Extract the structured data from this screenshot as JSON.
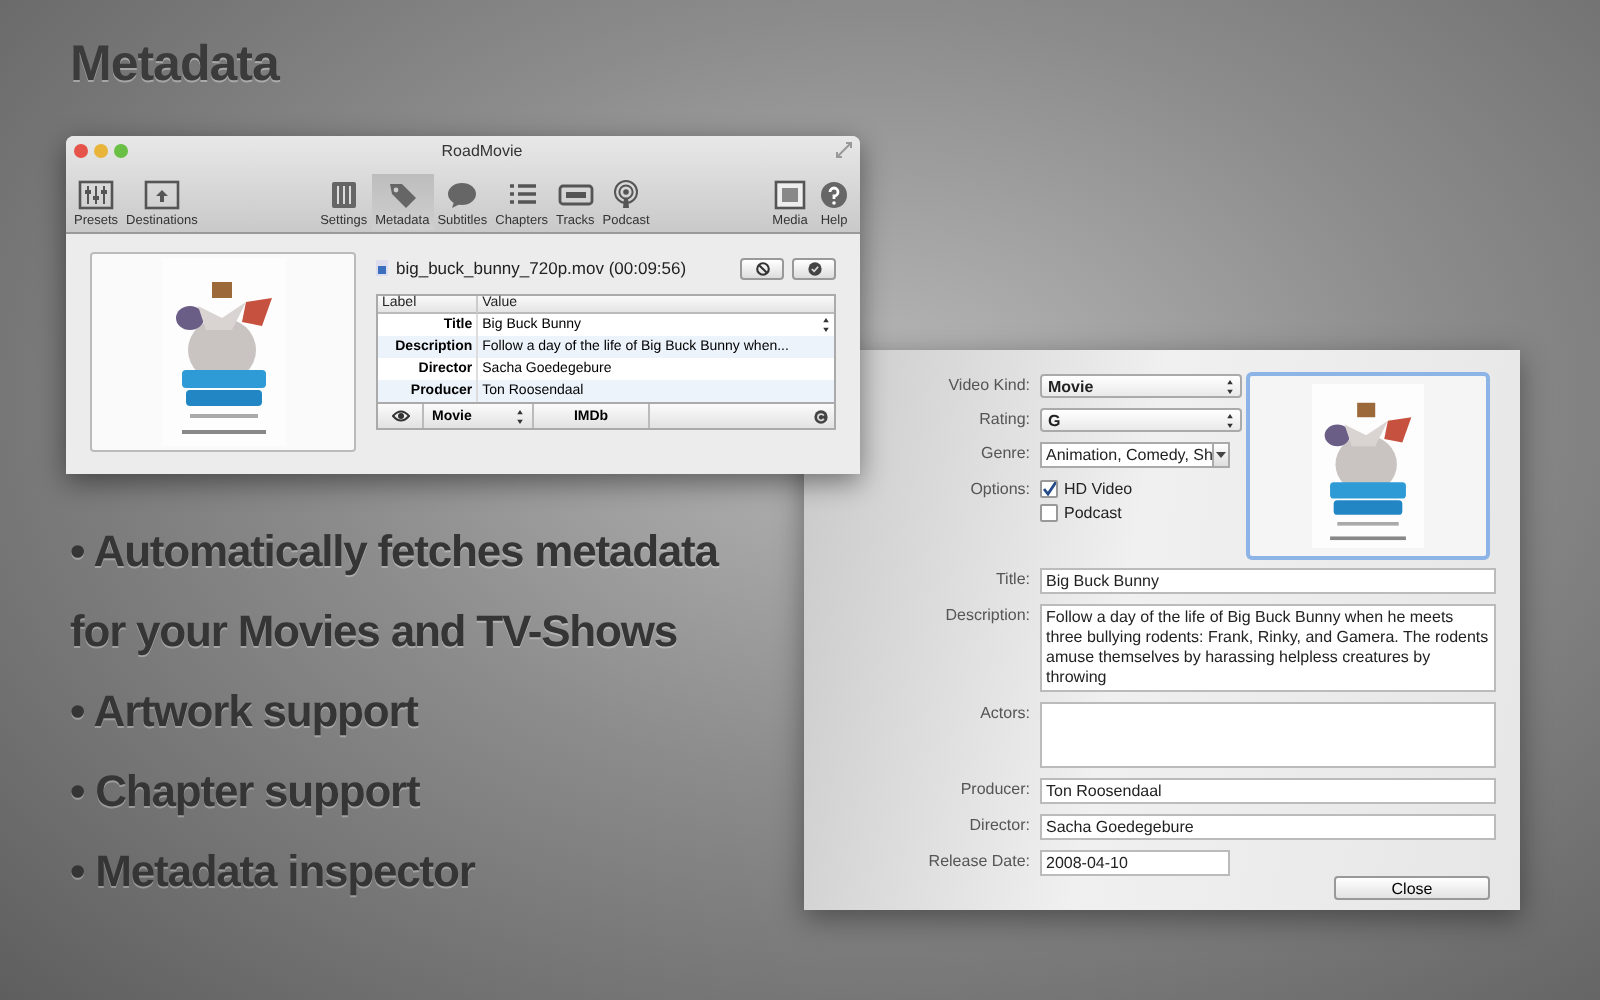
{
  "heading": "Metadata",
  "main_window": {
    "title": "RoadMovie",
    "toolbar_groups": [
      [
        {
          "label": "Presets",
          "selected": false
        },
        {
          "label": "Destinations",
          "selected": false
        }
      ],
      [
        {
          "label": "Settings",
          "selected": false
        },
        {
          "label": "Metadata",
          "selected": true
        },
        {
          "label": "Subtitles",
          "selected": false
        },
        {
          "label": "Chapters",
          "selected": false
        },
        {
          "label": "Tracks",
          "selected": false
        },
        {
          "label": "Podcast",
          "selected": false
        }
      ],
      [
        {
          "label": "Media",
          "selected": false
        },
        {
          "label": "Help",
          "selected": false
        }
      ]
    ],
    "file": "big_buck_bunny_720p.mov (00:09:56)",
    "table": {
      "columns": [
        "Label",
        "Value"
      ],
      "rows": [
        {
          "label": "Title",
          "value": "Big Buck Bunny",
          "popup": true
        },
        {
          "label": "Description",
          "value": "Follow a day of the life of Big Buck Bunny when...",
          "popup": false
        },
        {
          "label": "Director",
          "value": "Sacha Goedegebure",
          "popup": false
        },
        {
          "label": "Producer",
          "value": "Ton Roosendaal",
          "popup": false
        }
      ]
    },
    "footer": {
      "kind": "Movie",
      "source": "IMDb"
    }
  },
  "inspector": {
    "top_fields": [
      {
        "kind": "popup",
        "label": "Video Kind:",
        "value": "Movie"
      },
      {
        "kind": "popup",
        "label": "Rating:",
        "value": "G"
      },
      {
        "kind": "combo",
        "label": "Genre:",
        "value": "Animation, Comedy, Sh"
      },
      {
        "kind": "checkboxes",
        "label": "Options:",
        "options": [
          {
            "label": "HD Video",
            "checked": true
          },
          {
            "label": "Podcast",
            "checked": false
          }
        ]
      }
    ],
    "fields": [
      {
        "kind": "text",
        "label": "Title:",
        "value": "Big Buck Bunny"
      },
      {
        "kind": "textarea",
        "label": "Description:",
        "value": "Follow a day of the life of Big Buck Bunny when he meets three bullying rodents: Frank, Rinky, and Gamera. The rodents amuse themselves by harassing helpless creatures by throwing"
      },
      {
        "kind": "textarea",
        "label": "Actors:"
      },
      {
        "kind": "text",
        "label": "Producer:",
        "value": "Ton Roosendaal"
      },
      {
        "kind": "text",
        "label": "Director:",
        "value": "Sacha Goedegebure"
      },
      {
        "kind": "date",
        "label": "Release Date:",
        "value": "2008-04-10"
      }
    ],
    "button": "Close"
  },
  "features": [
    "• Automatically fetches metadata",
    "for your Movies and TV-Shows",
    "• Artwork support",
    "• Chapter support",
    "• Metadata inspector"
  ]
}
